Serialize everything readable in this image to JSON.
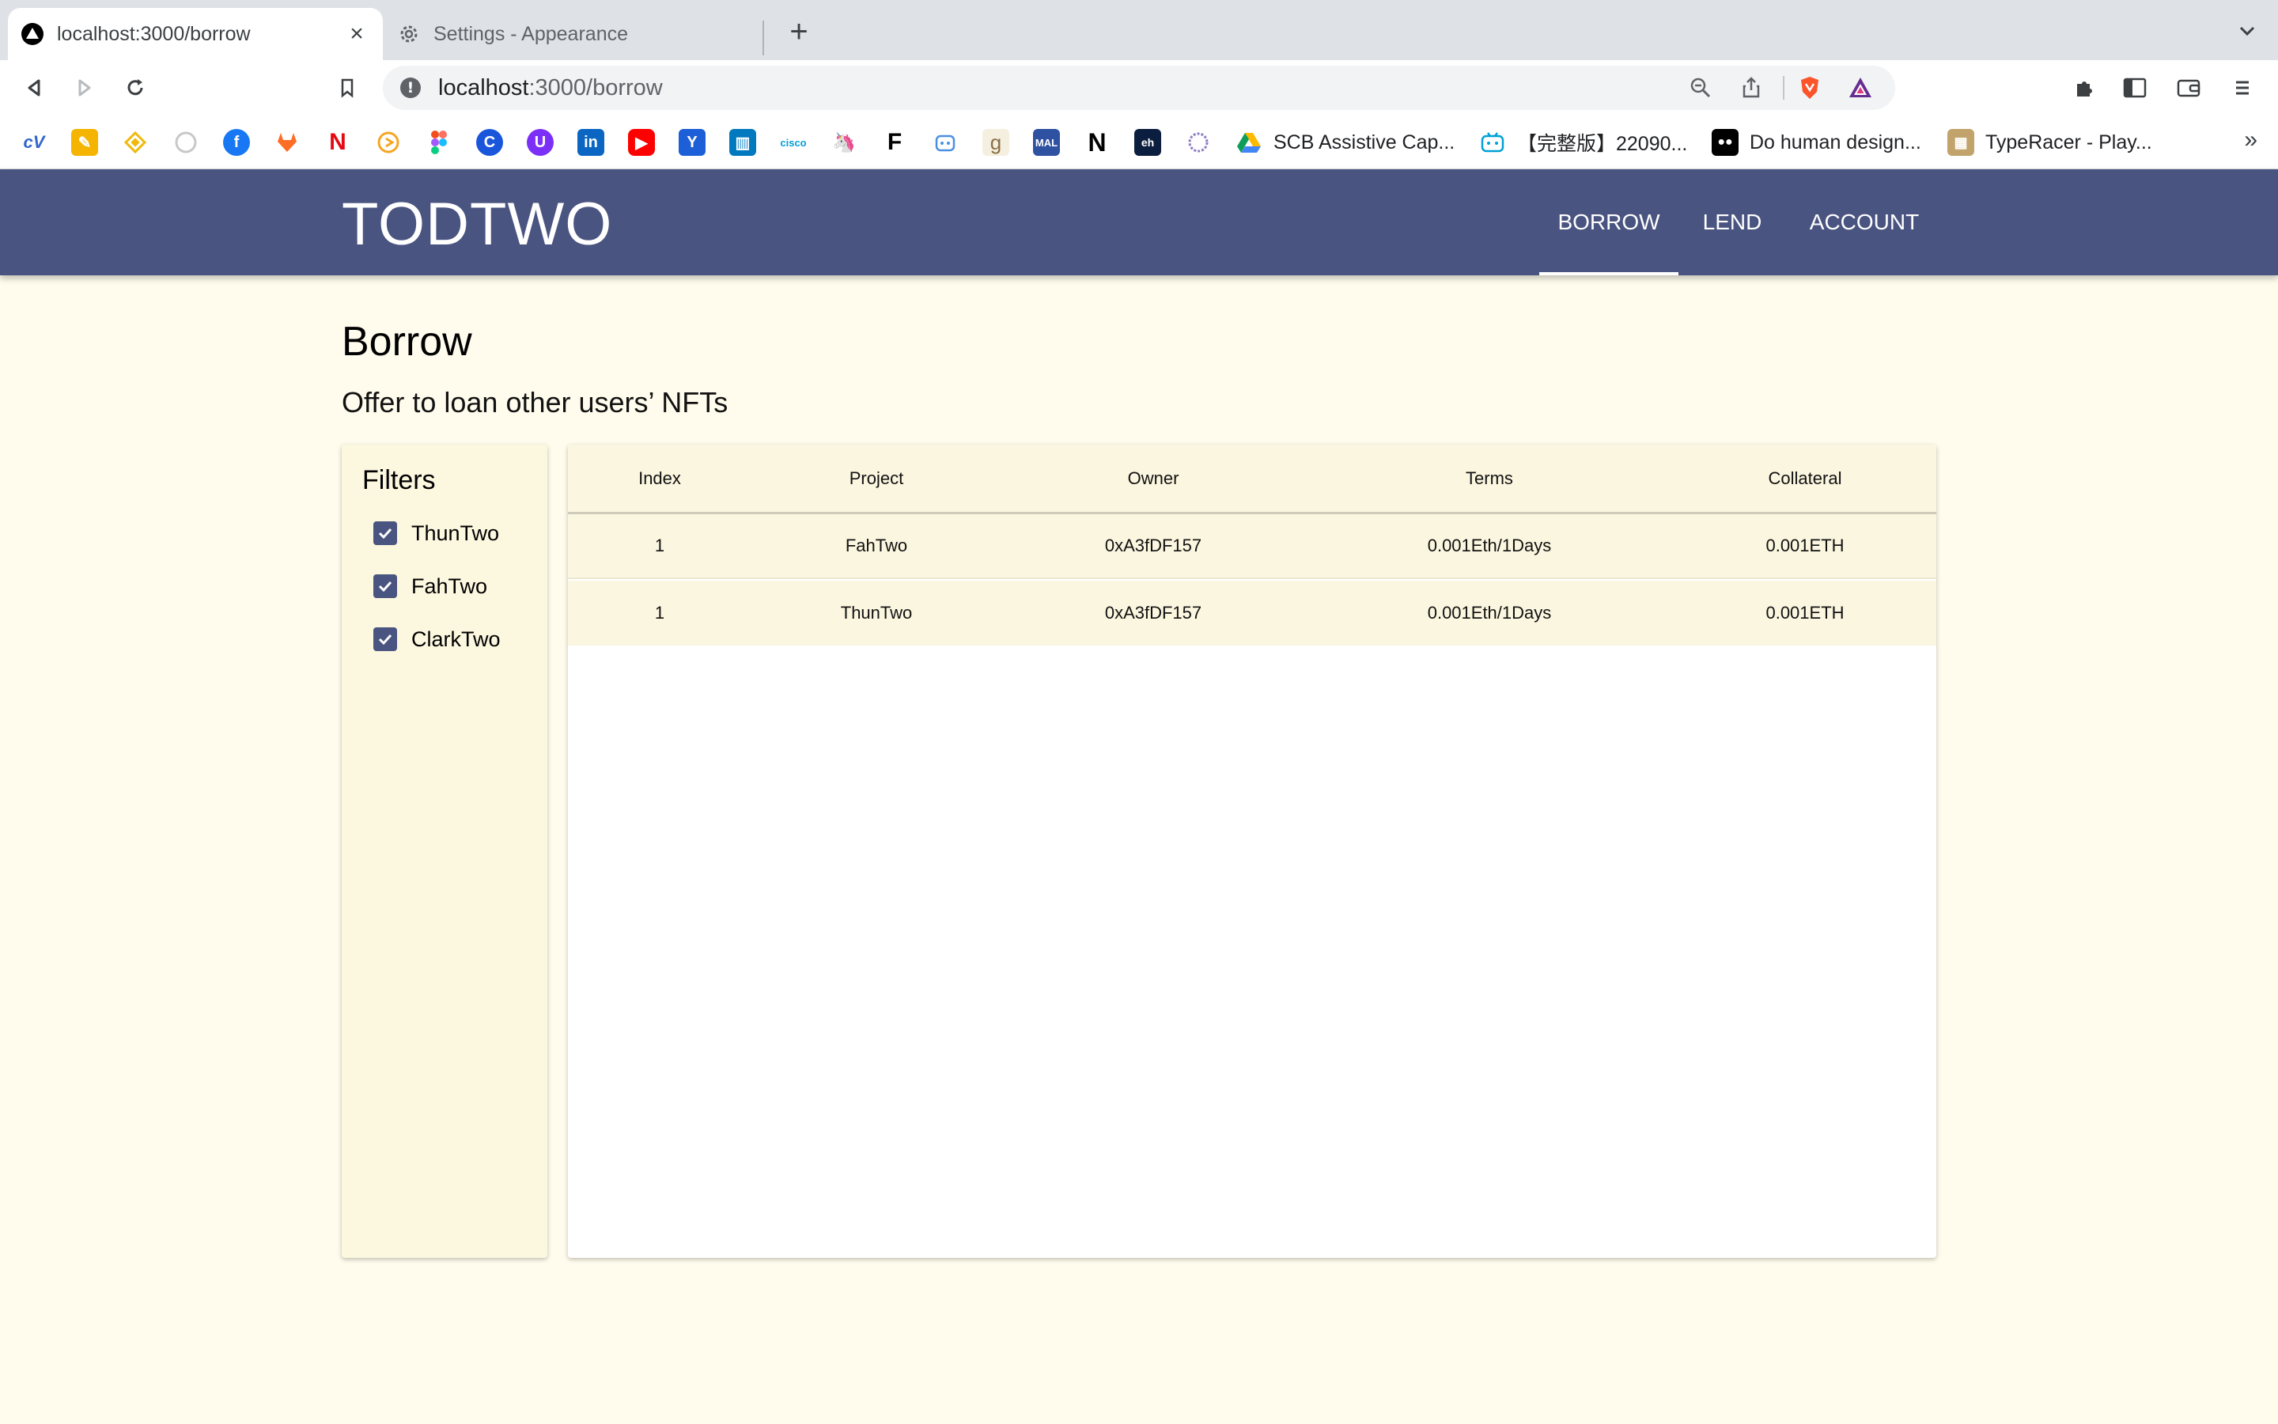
{
  "browser": {
    "tabs": [
      {
        "title": "localhost:3000/borrow",
        "active": true,
        "favicon": "triangle-logo-icon"
      },
      {
        "title": "Settings - Appearance",
        "active": false,
        "favicon": "gear-icon"
      }
    ],
    "url_host": "localhost",
    "url_path": ":3000/borrow",
    "bookmarks": [
      {
        "label": "SCB Assistive Cap...",
        "icon": "google-drive-icon"
      },
      {
        "label": "【完整版】22090...",
        "icon": "bilibili-icon"
      },
      {
        "label": "Do human design...",
        "icon": "medium-icon"
      },
      {
        "label": "TypeRacer - Play...",
        "icon": "typeracer-icon"
      }
    ]
  },
  "app": {
    "brand": "TODTWO",
    "nav": [
      {
        "label": "BORROW",
        "active": true
      },
      {
        "label": "LEND",
        "active": false
      },
      {
        "label": "ACCOUNT",
        "active": false
      }
    ],
    "accent_color": "#4a5480",
    "background_color": "#fffced"
  },
  "page": {
    "title": "Borrow",
    "subtitle": "Offer to loan other users’ NFTs"
  },
  "filters": {
    "title": "Filters",
    "items": [
      {
        "label": "ThunTwo",
        "checked": true
      },
      {
        "label": "FahTwo",
        "checked": true
      },
      {
        "label": "ClarkTwo",
        "checked": true
      }
    ]
  },
  "table": {
    "columns": [
      "Index",
      "Project",
      "Owner",
      "Terms",
      "Collateral"
    ],
    "rows": [
      [
        "1",
        "FahTwo",
        "0xA3fDF157",
        "0.001Eth/1Days",
        "0.001ETH"
      ],
      [
        "1",
        "ThunTwo",
        "0xA3fDF157",
        "0.001Eth/1Days",
        "0.001ETH"
      ]
    ]
  }
}
